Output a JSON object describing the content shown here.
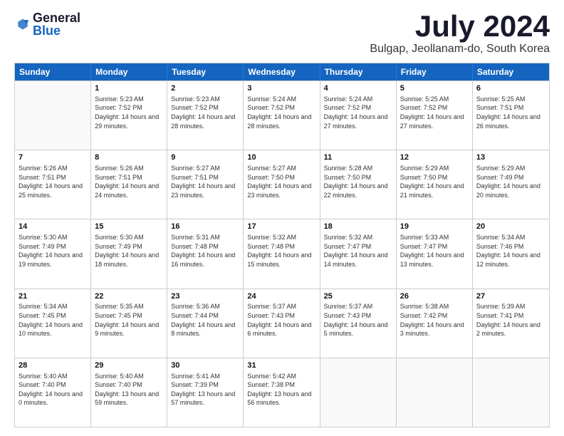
{
  "logo": {
    "general": "General",
    "blue": "Blue"
  },
  "header": {
    "month": "July 2024",
    "location": "Bulgap, Jeollanam-do, South Korea"
  },
  "days": [
    "Sunday",
    "Monday",
    "Tuesday",
    "Wednesday",
    "Thursday",
    "Friday",
    "Saturday"
  ],
  "weeks": [
    [
      {
        "day": "",
        "sunrise": "",
        "sunset": "",
        "daylight": ""
      },
      {
        "day": "1",
        "sunrise": "Sunrise: 5:23 AM",
        "sunset": "Sunset: 7:52 PM",
        "daylight": "Daylight: 14 hours and 29 minutes."
      },
      {
        "day": "2",
        "sunrise": "Sunrise: 5:23 AM",
        "sunset": "Sunset: 7:52 PM",
        "daylight": "Daylight: 14 hours and 28 minutes."
      },
      {
        "day": "3",
        "sunrise": "Sunrise: 5:24 AM",
        "sunset": "Sunset: 7:52 PM",
        "daylight": "Daylight: 14 hours and 28 minutes."
      },
      {
        "day": "4",
        "sunrise": "Sunrise: 5:24 AM",
        "sunset": "Sunset: 7:52 PM",
        "daylight": "Daylight: 14 hours and 27 minutes."
      },
      {
        "day": "5",
        "sunrise": "Sunrise: 5:25 AM",
        "sunset": "Sunset: 7:52 PM",
        "daylight": "Daylight: 14 hours and 27 minutes."
      },
      {
        "day": "6",
        "sunrise": "Sunrise: 5:25 AM",
        "sunset": "Sunset: 7:51 PM",
        "daylight": "Daylight: 14 hours and 26 minutes."
      }
    ],
    [
      {
        "day": "7",
        "sunrise": "Sunrise: 5:26 AM",
        "sunset": "Sunset: 7:51 PM",
        "daylight": "Daylight: 14 hours and 25 minutes."
      },
      {
        "day": "8",
        "sunrise": "Sunrise: 5:26 AM",
        "sunset": "Sunset: 7:51 PM",
        "daylight": "Daylight: 14 hours and 24 minutes."
      },
      {
        "day": "9",
        "sunrise": "Sunrise: 5:27 AM",
        "sunset": "Sunset: 7:51 PM",
        "daylight": "Daylight: 14 hours and 23 minutes."
      },
      {
        "day": "10",
        "sunrise": "Sunrise: 5:27 AM",
        "sunset": "Sunset: 7:50 PM",
        "daylight": "Daylight: 14 hours and 23 minutes."
      },
      {
        "day": "11",
        "sunrise": "Sunrise: 5:28 AM",
        "sunset": "Sunset: 7:50 PM",
        "daylight": "Daylight: 14 hours and 22 minutes."
      },
      {
        "day": "12",
        "sunrise": "Sunrise: 5:29 AM",
        "sunset": "Sunset: 7:50 PM",
        "daylight": "Daylight: 14 hours and 21 minutes."
      },
      {
        "day": "13",
        "sunrise": "Sunrise: 5:29 AM",
        "sunset": "Sunset: 7:49 PM",
        "daylight": "Daylight: 14 hours and 20 minutes."
      }
    ],
    [
      {
        "day": "14",
        "sunrise": "Sunrise: 5:30 AM",
        "sunset": "Sunset: 7:49 PM",
        "daylight": "Daylight: 14 hours and 19 minutes."
      },
      {
        "day": "15",
        "sunrise": "Sunrise: 5:30 AM",
        "sunset": "Sunset: 7:49 PM",
        "daylight": "Daylight: 14 hours and 18 minutes."
      },
      {
        "day": "16",
        "sunrise": "Sunrise: 5:31 AM",
        "sunset": "Sunset: 7:48 PM",
        "daylight": "Daylight: 14 hours and 16 minutes."
      },
      {
        "day": "17",
        "sunrise": "Sunrise: 5:32 AM",
        "sunset": "Sunset: 7:48 PM",
        "daylight": "Daylight: 14 hours and 15 minutes."
      },
      {
        "day": "18",
        "sunrise": "Sunrise: 5:32 AM",
        "sunset": "Sunset: 7:47 PM",
        "daylight": "Daylight: 14 hours and 14 minutes."
      },
      {
        "day": "19",
        "sunrise": "Sunrise: 5:33 AM",
        "sunset": "Sunset: 7:47 PM",
        "daylight": "Daylight: 14 hours and 13 minutes."
      },
      {
        "day": "20",
        "sunrise": "Sunrise: 5:34 AM",
        "sunset": "Sunset: 7:46 PM",
        "daylight": "Daylight: 14 hours and 12 minutes."
      }
    ],
    [
      {
        "day": "21",
        "sunrise": "Sunrise: 5:34 AM",
        "sunset": "Sunset: 7:45 PM",
        "daylight": "Daylight: 14 hours and 10 minutes."
      },
      {
        "day": "22",
        "sunrise": "Sunrise: 5:35 AM",
        "sunset": "Sunset: 7:45 PM",
        "daylight": "Daylight: 14 hours and 9 minutes."
      },
      {
        "day": "23",
        "sunrise": "Sunrise: 5:36 AM",
        "sunset": "Sunset: 7:44 PM",
        "daylight": "Daylight: 14 hours and 8 minutes."
      },
      {
        "day": "24",
        "sunrise": "Sunrise: 5:37 AM",
        "sunset": "Sunset: 7:43 PM",
        "daylight": "Daylight: 14 hours and 6 minutes."
      },
      {
        "day": "25",
        "sunrise": "Sunrise: 5:37 AM",
        "sunset": "Sunset: 7:43 PM",
        "daylight": "Daylight: 14 hours and 5 minutes."
      },
      {
        "day": "26",
        "sunrise": "Sunrise: 5:38 AM",
        "sunset": "Sunset: 7:42 PM",
        "daylight": "Daylight: 14 hours and 3 minutes."
      },
      {
        "day": "27",
        "sunrise": "Sunrise: 5:39 AM",
        "sunset": "Sunset: 7:41 PM",
        "daylight": "Daylight: 14 hours and 2 minutes."
      }
    ],
    [
      {
        "day": "28",
        "sunrise": "Sunrise: 5:40 AM",
        "sunset": "Sunset: 7:40 PM",
        "daylight": "Daylight: 14 hours and 0 minutes."
      },
      {
        "day": "29",
        "sunrise": "Sunrise: 5:40 AM",
        "sunset": "Sunset: 7:40 PM",
        "daylight": "Daylight: 13 hours and 59 minutes."
      },
      {
        "day": "30",
        "sunrise": "Sunrise: 5:41 AM",
        "sunset": "Sunset: 7:39 PM",
        "daylight": "Daylight: 13 hours and 57 minutes."
      },
      {
        "day": "31",
        "sunrise": "Sunrise: 5:42 AM",
        "sunset": "Sunset: 7:38 PM",
        "daylight": "Daylight: 13 hours and 56 minutes."
      },
      {
        "day": "",
        "sunrise": "",
        "sunset": "",
        "daylight": ""
      },
      {
        "day": "",
        "sunrise": "",
        "sunset": "",
        "daylight": ""
      },
      {
        "day": "",
        "sunrise": "",
        "sunset": "",
        "daylight": ""
      }
    ]
  ]
}
